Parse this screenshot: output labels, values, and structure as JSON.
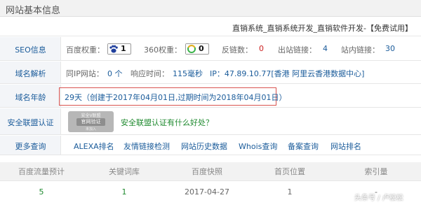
{
  "panel": {
    "title": "网站基本信息"
  },
  "site": {
    "name": "直销系统_直销系统开发_直销软件开发-【免费试用】"
  },
  "seo": {
    "label": "SEO信息",
    "baidu_weight_label": "百度权重：",
    "baidu_weight_value": "1",
    "w360_label": "360权重：",
    "w360_value": "0",
    "backlinks_label": "反链数：",
    "backlinks_value": "0",
    "outlinks_label": "出站链接：",
    "outlinks_value": "4",
    "inlinks_label": "站内链接：",
    "inlinks_value": "30"
  },
  "dns": {
    "label": "域名解析",
    "same_ip_label": "同IP网站：",
    "same_ip_value": "0 个",
    "response_label": "响应时间：",
    "response_value": "115毫秒",
    "ip_text": "IP：47.89.10.77[香港 阿里云香港数据中心]"
  },
  "age": {
    "label": "域名年龄",
    "text": "29天（创建于2017年04月01日,过期时间为2018年04月01日）"
  },
  "alliance": {
    "label": "安全联盟认证",
    "seal": {
      "top": "安全V联盟",
      "middle": "官网验证",
      "bottom": "未加入"
    },
    "link_text": "安全联盟认证有什么好处？"
  },
  "more": {
    "label": "更多查询",
    "links": [
      "ALEXA排名",
      "友情链接检测",
      "网站历史数据",
      "Whois查询",
      "备案查询",
      "网站排名"
    ]
  },
  "table": {
    "headers": [
      "百度流量预计",
      "关键词库",
      "百度快照",
      "首页位置",
      "索引量"
    ],
    "row": [
      "5",
      "1",
      "2017-04-27",
      "1",
      "-"
    ]
  },
  "watermark": "头条号 / 卢松松",
  "colors": {
    "link": "#1a5b9a",
    "green": "#1f8a2f",
    "red": "#cc2222",
    "box_border": "#d9534f"
  }
}
